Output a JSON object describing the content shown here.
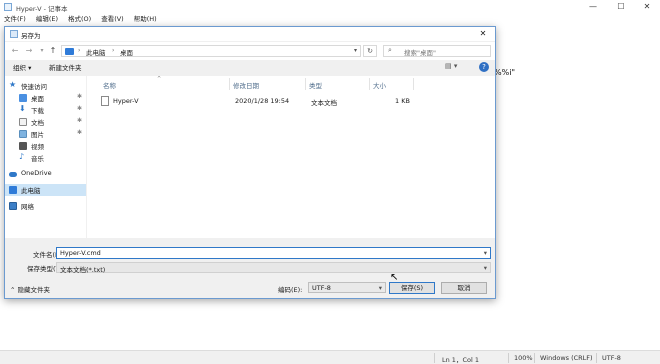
{
  "notepad": {
    "title": "Hyper-V - 记事本",
    "menu": [
      "文件(F)",
      "编辑(E)",
      "格式(O)",
      "查看(V)",
      "帮助(H)"
    ],
    "window_controls": [
      "—",
      "☐",
      "✕"
    ],
    "text_fragment": "%%i\"",
    "status": {
      "position": "Ln 1，Col 1",
      "zoom": "100%",
      "line_ending": "Windows (CRLF)",
      "encoding": "UTF-8"
    }
  },
  "dialog": {
    "title": "另存为",
    "breadcrumb": [
      "此电脑",
      "桌面"
    ],
    "search_placeholder": "搜索\"桌面\"",
    "toolbar": {
      "organize": "组织 ▾",
      "new_folder": "新建文件夹"
    },
    "nav_items": [
      {
        "label": "快速访问",
        "icon": "star-icon",
        "pinned": false
      },
      {
        "label": "桌面",
        "icon": "desktop-icon",
        "pinned": true
      },
      {
        "label": "下载",
        "icon": "download-icon",
        "pinned": true
      },
      {
        "label": "文档",
        "icon": "document-icon",
        "pinned": true
      },
      {
        "label": "图片",
        "icon": "picture-icon",
        "pinned": true
      },
      {
        "label": "视频",
        "icon": "video-icon",
        "pinned": false
      },
      {
        "label": "音乐",
        "icon": "music-icon",
        "pinned": false
      },
      {
        "label": "OneDrive",
        "icon": "cloud-icon",
        "pinned": false
      },
      {
        "label": "此电脑",
        "icon": "computer-icon",
        "pinned": false
      },
      {
        "label": "网络",
        "icon": "network-icon",
        "pinned": false
      }
    ],
    "columns": [
      "名称",
      "修改日期",
      "类型",
      "大小"
    ],
    "files": [
      {
        "name": "Hyper-V",
        "modified": "2020/1/28 19:54",
        "type": "文本文档",
        "size": "1 KB"
      }
    ],
    "filename_label": "文件名(N):",
    "filename_value": "Hyper-V.cmd",
    "type_label": "保存类型(T):",
    "type_value": "文本文档(*.txt)",
    "hide_folders": "隐藏文件夹",
    "encoding_label": "编码(E):",
    "encoding_value": "UTF-8",
    "save_button": "保存(S)",
    "cancel_button": "取消"
  }
}
